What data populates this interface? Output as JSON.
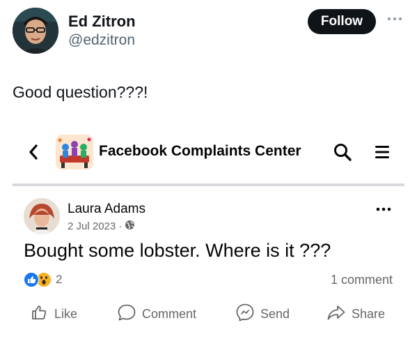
{
  "tweet": {
    "author_name": "Ed Zitron",
    "author_handle": "@edzitron",
    "follow_label": "Follow",
    "text": "Good question???!"
  },
  "embed": {
    "group_name": "Facebook Complaints Center",
    "post": {
      "author": "Laura Adams",
      "date": "2 Jul 2023 ·",
      "text": "Bought some lobster. Where is it ???",
      "reaction_count": "2",
      "comment_count": "1 comment"
    },
    "actions": {
      "like": "Like",
      "comment": "Comment",
      "send": "Send",
      "share": "Share"
    }
  },
  "icons": {
    "like_reaction_color": "#1877f2",
    "wow_reaction_color": "#f7b125"
  }
}
